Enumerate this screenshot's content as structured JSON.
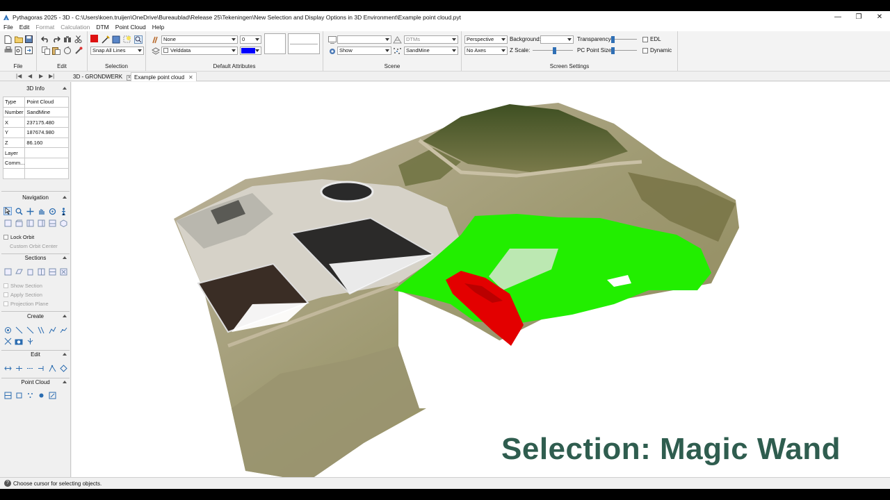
{
  "window": {
    "title": "Pythagoras 2025 - 3D - C:\\Users\\koen.truijen\\OneDrive\\Bureaublad\\Release 25\\Tekeningen\\New Selection and Display Options in 3D Environment\\Example point cloud.pyt",
    "minimize": "—",
    "maximize": "❐",
    "close": "✕"
  },
  "menu": {
    "items": [
      "File",
      "Edit",
      "Format",
      "Calculation",
      "DTM",
      "Point Cloud",
      "Help"
    ],
    "disabled": [
      "Format",
      "Calculation"
    ]
  },
  "ribbon": {
    "groups": {
      "file": "File",
      "edit": "Edit",
      "selection": "Selection",
      "default_attributes": "Default Attributes",
      "scene": "Scene",
      "screen_settings": "Screen Settings"
    },
    "selection_mode": "Snap All Lines",
    "attr_line_style": "None",
    "attr_number": "0",
    "attr_layer": "Velddata",
    "attr_color": "#0000ff",
    "scene_top": "",
    "scene_dtms": "DTMs",
    "scene_show": "Show",
    "scene_pointcloud": "SandMine",
    "projection": "Perspective",
    "axes": "No Axes",
    "background_label": "Background:",
    "background_value": "",
    "zscale_label": "Z Scale:",
    "zscale_level": 0.55,
    "transparency_label": "Transparency:",
    "transparency_level": 0.02,
    "pc_point_size_label": "PC Point Size:",
    "pc_point_size_level": 0.02,
    "edl_label": "EDL",
    "dynamic_label": "Dynamic"
  },
  "tabs": {
    "items": [
      {
        "label": "3D - GRONDWERK",
        "active": false
      },
      {
        "label": "Example point cloud",
        "active": true
      }
    ]
  },
  "info_panel": {
    "title": "3D Info",
    "rows": [
      {
        "key": "Type",
        "value": "Point Cloud"
      },
      {
        "key": "Number",
        "value": "SandMine"
      },
      {
        "key": "X",
        "value": "237175.480"
      },
      {
        "key": "Y",
        "value": "187674.980"
      },
      {
        "key": "Z",
        "value": "86.160"
      },
      {
        "key": "Layer",
        "value": ""
      },
      {
        "key": "Comm...",
        "value": ""
      },
      {
        "key": "",
        "value": ""
      }
    ]
  },
  "navigation": {
    "title": "Navigation",
    "lock_orbit": "Lock Orbit",
    "custom_orbit_center": "Custom Orbit Center"
  },
  "sections": {
    "title": "Sections",
    "show_section": "Show Section",
    "apply_section": "Apply Section",
    "projection_plane": "Projection Plane"
  },
  "create": {
    "title": "Create"
  },
  "edit_panel": {
    "title": "Edit"
  },
  "point_cloud_panel": {
    "title": "Point Cloud"
  },
  "viewport": {
    "caption": "Selection: Magic Wand",
    "selection_color": "#22ee00",
    "magic_wand_color": "#e30000"
  },
  "status": {
    "text": "Choose cursor for selecting objects."
  }
}
